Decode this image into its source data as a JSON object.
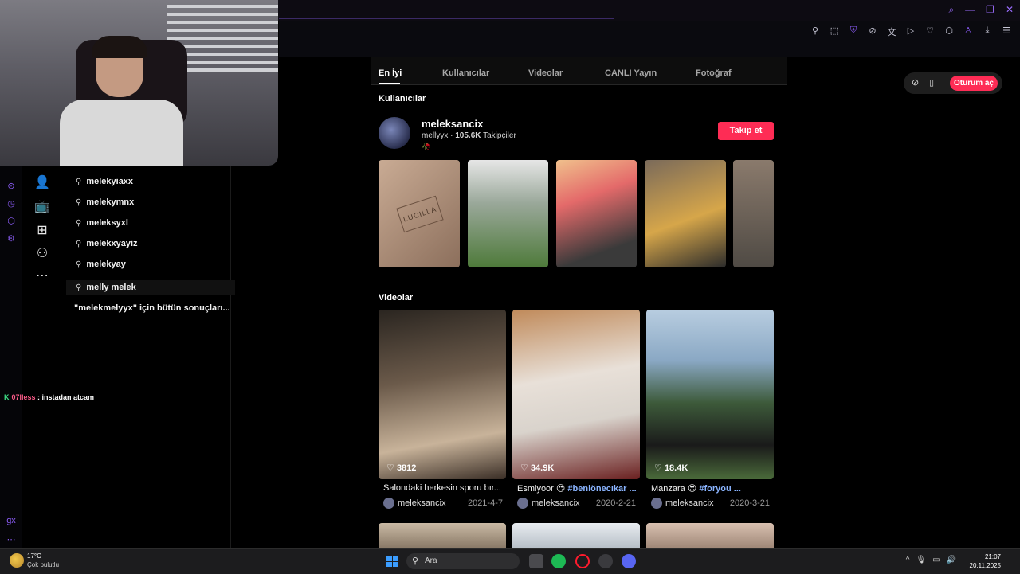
{
  "colors": {
    "accent": "#fe2c55",
    "opera": "#8b5cf6",
    "hashtag": "#8ab4ff"
  },
  "icons": [
    "search-icon",
    "user-plus-icon",
    "live-icon",
    "upload-icon",
    "profile-icon",
    "more-icon",
    "heart-icon",
    "compass-icon",
    "phone-icon"
  ],
  "search_suggestions": [
    "melekyiaxx",
    "melekymnx",
    "meleksyxl",
    "melekxyayiz",
    "melekyay",
    "melly melek"
  ],
  "all_results_label": "\"melekmelyyx\" için bütün sonuçları...",
  "chat": {
    "user": "07lless",
    "message": " : instadan atcam"
  },
  "tabs": [
    "En İyi",
    "Kullanıcılar",
    "Videolar",
    "CANLI Yayın",
    "Fotoğraf"
  ],
  "users_section": {
    "title": "Kullanıcılar",
    "name": "meleksancix",
    "handle": "mellyyx",
    "separator": " · ",
    "followers": "105.6K",
    "followers_label": "Takipçiler",
    "follow_label": "Takip et"
  },
  "thumbs": [
    {
      "text": "LUCILLA",
      "bg": "#b89a84"
    },
    {
      "text": "",
      "bg": "#6f8a55"
    },
    {
      "text": "",
      "bg": "#e46a6a"
    },
    {
      "text": "",
      "bg": "#d6a64a"
    },
    {
      "text": "",
      "bg": "#8a7a6c"
    }
  ],
  "videos_section": {
    "title": "Videolar",
    "items": [
      {
        "likes": "3812",
        "title": "Salondaki herkesin sporu bır...",
        "tag": "",
        "author": "meleksancix",
        "date": "2021-4-7",
        "bg": "#6b5a4a"
      },
      {
        "likes": "34.9K",
        "title": "Esmiyoor 😍 ",
        "tag": "#beniönecıkar ...",
        "author": "meleksancix",
        "date": "2020-2-21",
        "bg": "#a88b6a"
      },
      {
        "likes": "18.4K",
        "title": "Manzara 😍 ",
        "tag": "#foryou ...",
        "author": "meleksancix",
        "date": "2020-3-21",
        "bg": "#5a7c8a"
      }
    ]
  },
  "login_label": "Oturum aç",
  "taskbar": {
    "temp": "17°C",
    "weather": "Çok bulutlu",
    "search": "Ara",
    "time": "21:07",
    "date": "20.11.2025"
  }
}
